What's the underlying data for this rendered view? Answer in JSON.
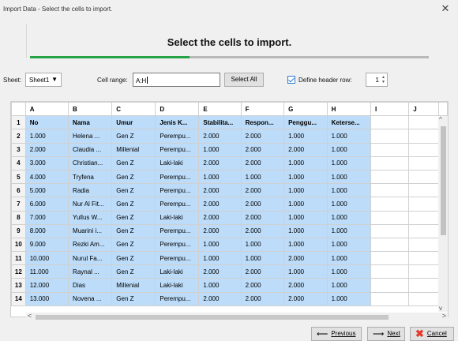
{
  "window": {
    "title": "Import Data - Select the cells to import."
  },
  "wizard": {
    "heading": "Select the cells to import.",
    "progress": 0.4
  },
  "toolbar": {
    "sheet_label": "Sheet:",
    "sheet_value": "Sheet1",
    "range_label": "Cell range:",
    "range_value": "A:H",
    "select_all": "Select All",
    "define_header_label": "Define header row:",
    "define_header_checked": true,
    "header_row_value": "1"
  },
  "grid": {
    "columns": [
      "A",
      "B",
      "C",
      "D",
      "E",
      "F",
      "G",
      "H",
      "I",
      "J"
    ],
    "rows": [
      {
        "n": "1",
        "cells": [
          "No",
          "Nama",
          "Umur",
          "Jenis K...",
          "Stabilita...",
          "Respon...",
          "Penggu...",
          "Keterse..."
        ]
      },
      {
        "n": "2",
        "cells": [
          "1.000",
          "Helena ...",
          "Gen Z",
          "Perempu...",
          "2.000",
          "2.000",
          "1.000",
          "1.000"
        ]
      },
      {
        "n": "3",
        "cells": [
          "2.000",
          "Claudia ...",
          "Millenial",
          "Perempu...",
          "1.000",
          "2.000",
          "2.000",
          "1.000"
        ]
      },
      {
        "n": "4",
        "cells": [
          "3.000",
          "Christian...",
          "Gen Z",
          "Laki-laki",
          "2.000",
          "2.000",
          "1.000",
          "1.000"
        ]
      },
      {
        "n": "5",
        "cells": [
          "4.000",
          "Tryfena",
          "Gen Z",
          "Perempu...",
          "1.000",
          "1.000",
          "1.000",
          "1.000"
        ]
      },
      {
        "n": "6",
        "cells": [
          "5.000",
          "Radia",
          "Gen Z",
          "Perempu...",
          "2.000",
          "2.000",
          "1.000",
          "1.000"
        ]
      },
      {
        "n": "7",
        "cells": [
          "6.000",
          "Nur Al Fit...",
          "Gen Z",
          "Perempu...",
          "2.000",
          "2.000",
          "1.000",
          "1.000"
        ]
      },
      {
        "n": "8",
        "cells": [
          "7.000",
          "Yullus W...",
          "Gen Z",
          "Laki-laki",
          "2.000",
          "2.000",
          "1.000",
          "1.000"
        ]
      },
      {
        "n": "9",
        "cells": [
          "8.000",
          "Muarini i...",
          "Gen Z",
          "Perempu...",
          "2.000",
          "2.000",
          "1.000",
          "1.000"
        ]
      },
      {
        "n": "10",
        "cells": [
          "9.000",
          "Rezki Am...",
          "Gen Z",
          "Perempu...",
          "1.000",
          "1.000",
          "1.000",
          "1.000"
        ]
      },
      {
        "n": "11",
        "cells": [
          "10.000",
          "Nurul Fa...",
          "Gen Z",
          "Perempu...",
          "1.000",
          "1.000",
          "2.000",
          "1.000"
        ]
      },
      {
        "n": "12",
        "cells": [
          "11.000",
          "Raynal ...",
          "Gen Z",
          "Laki-laki",
          "2.000",
          "2.000",
          "1.000",
          "1.000"
        ]
      },
      {
        "n": "13",
        "cells": [
          "12.000",
          "Dias",
          "Millenial",
          "Laki-laki",
          "1.000",
          "2.000",
          "2.000",
          "1.000"
        ]
      },
      {
        "n": "14",
        "cells": [
          "13.000",
          "Novena ...",
          "Gen Z",
          "Perempu...",
          "2.000",
          "2.000",
          "2.000",
          "1.000"
        ]
      }
    ]
  },
  "footer": {
    "previous": "Previous",
    "next": "Next",
    "cancel": "Cancel"
  },
  "colors": {
    "selected_cell": "#bcdcf9",
    "progress": "#27a245",
    "cancel_icon": "#e53929"
  }
}
